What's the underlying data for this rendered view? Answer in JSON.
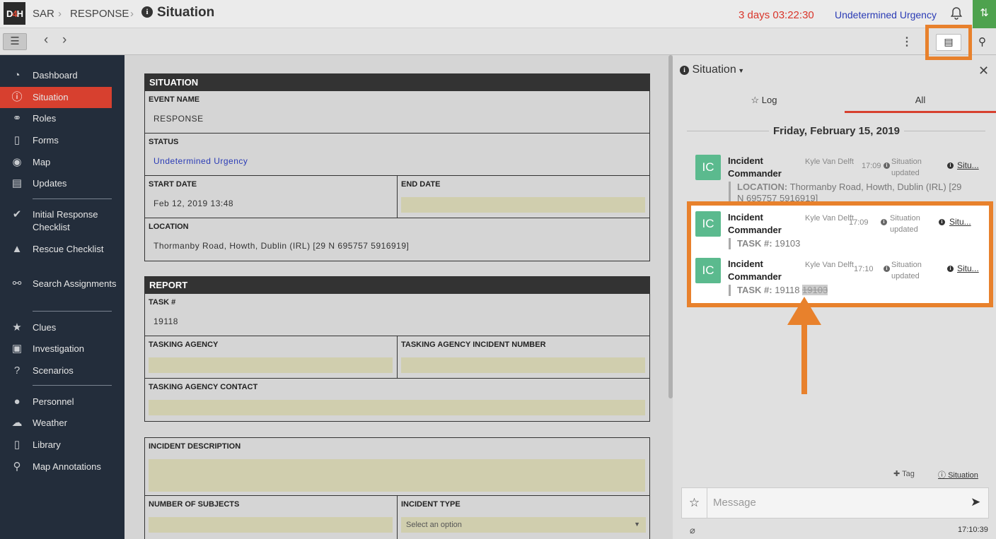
{
  "app": {
    "logo_prefix": "D",
    "logo_mid": "4",
    "logo_suffix": "H"
  },
  "breadcrumb": {
    "items": [
      "SAR",
      "RESPONSE"
    ],
    "sep": "›",
    "page_title": "Situation"
  },
  "header": {
    "timer": "3 days 03:22:30",
    "urgency": "Undetermined Urgency"
  },
  "sidebar": {
    "items": [
      {
        "label": "Dashboard",
        "icon": "dashboard-icon"
      },
      {
        "label": "Situation",
        "icon": "info-icon",
        "active": true
      },
      {
        "label": "Roles",
        "icon": "org-chart-icon"
      },
      {
        "label": "Forms",
        "icon": "document-icon"
      },
      {
        "label": "Map",
        "icon": "globe-icon"
      },
      {
        "label": "Updates",
        "icon": "chat-icon"
      },
      {
        "label": "Initial Response Checklist",
        "icon": "check-icon"
      },
      {
        "label": "Rescue Checklist",
        "icon": "warning-icon"
      },
      {
        "label": "Search Assignments",
        "icon": "binoculars-icon"
      },
      {
        "label": "Clues",
        "icon": "star-icon"
      },
      {
        "label": "Investigation",
        "icon": "briefcase-icon"
      },
      {
        "label": "Scenarios",
        "icon": "question-icon"
      },
      {
        "label": "Personnel",
        "icon": "person-icon"
      },
      {
        "label": "Weather",
        "icon": "weather-icon"
      },
      {
        "label": "Library",
        "icon": "pdf-icon"
      },
      {
        "label": "Map Annotations",
        "icon": "pin-icon"
      }
    ]
  },
  "situation": {
    "heading": "SITUATION",
    "event_name_label": "EVENT NAME",
    "event_name": "RESPONSE",
    "status_label": "STATUS",
    "status": "Undetermined Urgency",
    "start_date_label": "START DATE",
    "start_date": "Feb 12, 2019 13:48",
    "end_date_label": "END DATE",
    "location_label": "LOCATION",
    "location": "Thormanby Road, Howth, Dublin (IRL) [29 N 695757 5916919]"
  },
  "report": {
    "heading": "REPORT",
    "task_label": "TASK #",
    "task": "19118",
    "agency_label": "TASKING AGENCY",
    "agency_incident_label": "TASKING AGENCY INCIDENT NUMBER",
    "agency_contact_label": "TASKING AGENCY CONTACT",
    "incident_desc_label": "INCIDENT DESCRIPTION",
    "num_subjects_label": "NUMBER OF SUBJECTS",
    "incident_type_label": "INCIDENT TYPE",
    "incident_type_placeholder": "Select an option"
  },
  "right_panel": {
    "title": "Situation",
    "tabs": [
      "Log",
      "All"
    ],
    "day": "Friday, February 15, 2019",
    "entries": [
      {
        "initials": "IC",
        "who": "Incident Commander",
        "user": "Kyle Van Delft",
        "time": "17:09",
        "action": "Situation updated",
        "link": "Situ...",
        "field": "LOCATION:",
        "value": "Thormanby Road, Howth, Dublin (IRL) [29 N 695757 5916919]",
        "old": ""
      },
      {
        "initials": "IC",
        "who": "Incident Commander",
        "user": "Kyle Van Delft",
        "time": "17:09",
        "action": "Situation updated",
        "link": "Situ...",
        "field": "TASK #:",
        "value": "19103",
        "old": ""
      },
      {
        "initials": "IC",
        "who": "Incident Commander",
        "user": "Kyle Van Delft",
        "time": "17:10",
        "action": "Situation updated",
        "link": "Situ...",
        "field": "TASK #:",
        "value": "19118",
        "old": "19103"
      }
    ],
    "tag_label": "Tag",
    "situation_link": "Situation",
    "message_placeholder": "Message",
    "clock": "17:10:39"
  },
  "colors": {
    "accent": "#d7402f",
    "highlight": "#e8812c",
    "sidebar": "#232d3b",
    "avatar": "#5bba8e"
  }
}
